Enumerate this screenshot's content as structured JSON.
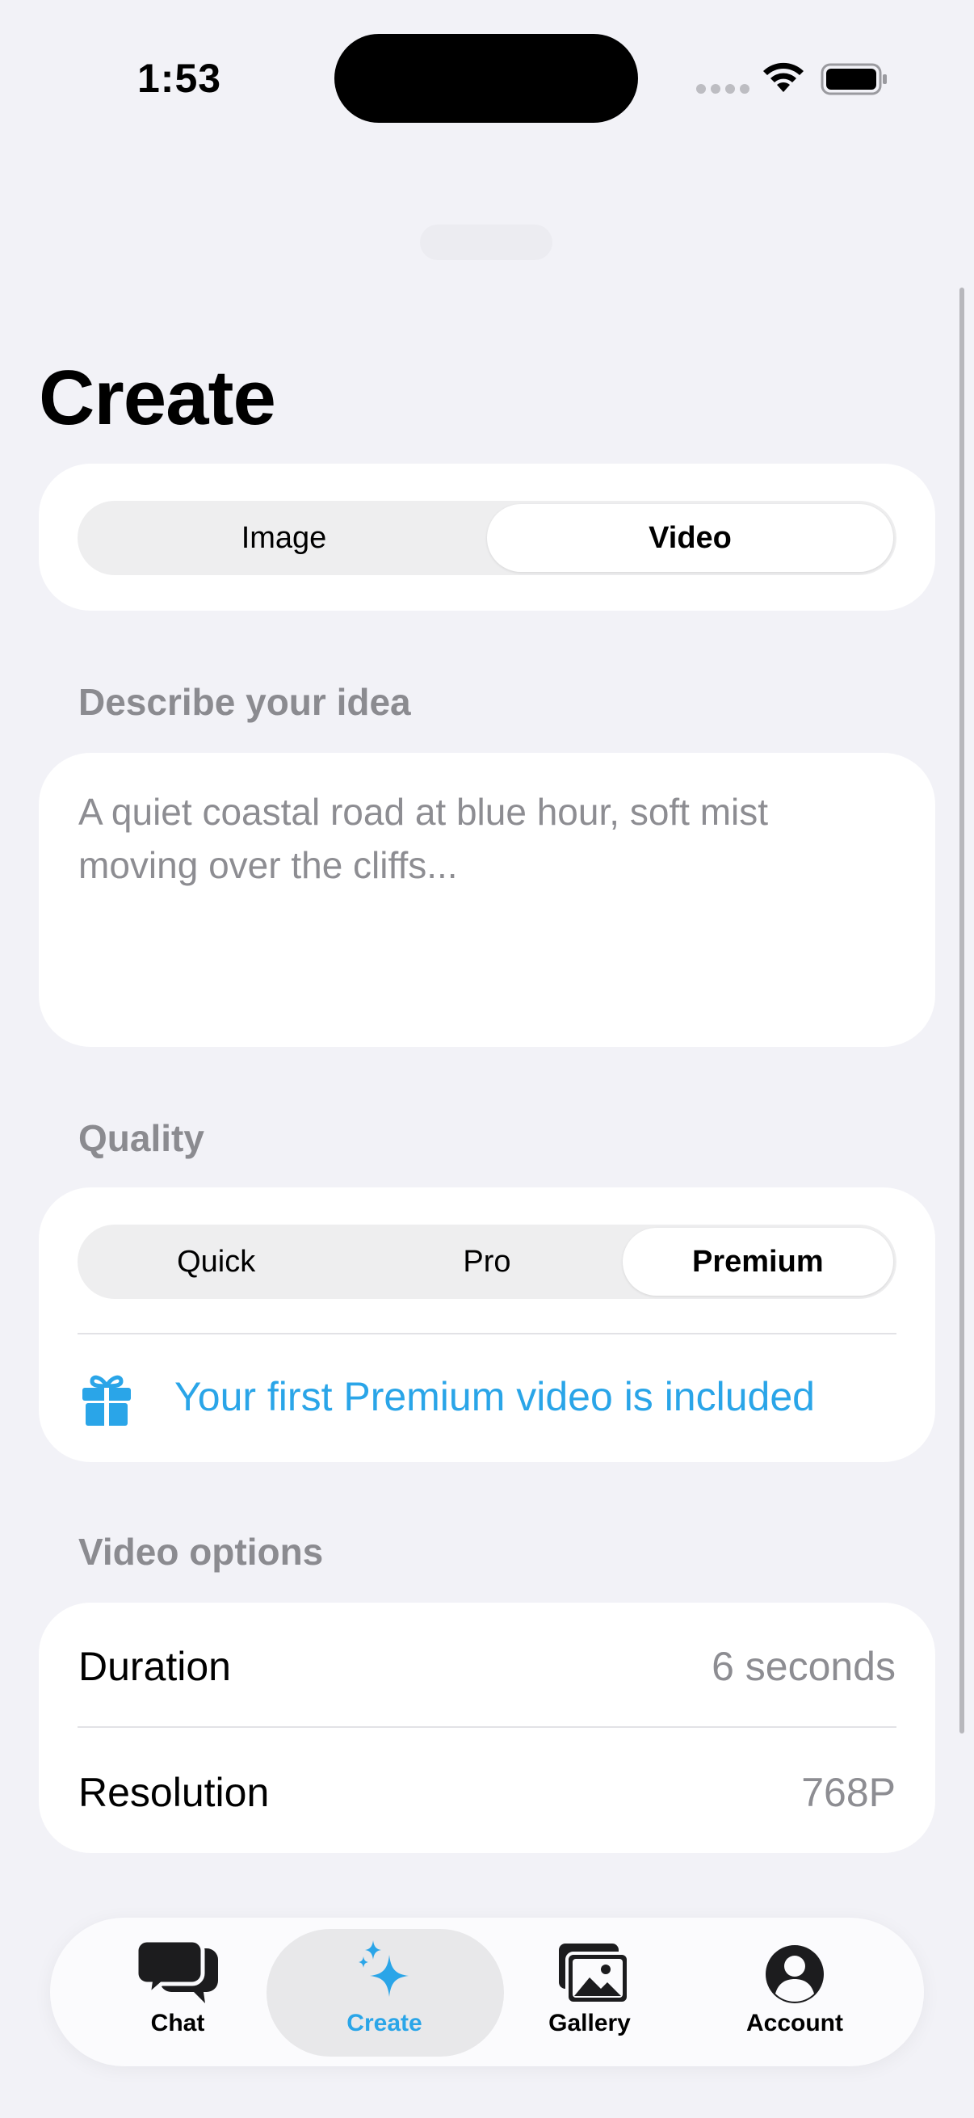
{
  "status_bar": {
    "time": "1:53"
  },
  "page": {
    "title": "Create"
  },
  "media_toggle": {
    "options": [
      "Image",
      "Video"
    ],
    "selected": "Video"
  },
  "prompt": {
    "label": "Describe your idea",
    "placeholder": "A quiet coastal road at blue hour, soft mist moving over the cliffs..."
  },
  "quality": {
    "label": "Quality",
    "options": [
      "Quick",
      "Pro",
      "Premium"
    ],
    "selected": "Premium",
    "promo_text": "Your first Premium video is included",
    "promo_icon": "gift-icon"
  },
  "video_options": {
    "label": "Video options",
    "rows": [
      {
        "label": "Duration",
        "value": "6 seconds"
      },
      {
        "label": "Resolution",
        "value": "768P"
      }
    ]
  },
  "tab_bar": {
    "tabs": [
      {
        "label": "Chat",
        "icon": "chat-bubbles-icon"
      },
      {
        "label": "Create",
        "icon": "sparkles-icon"
      },
      {
        "label": "Gallery",
        "icon": "photos-icon"
      },
      {
        "label": "Account",
        "icon": "person-circle-icon"
      }
    ],
    "selected": "Create"
  },
  "colors": {
    "accent": "#2aa5e8",
    "background": "#f2f2f7",
    "secondary_text": "#8d8d92"
  }
}
